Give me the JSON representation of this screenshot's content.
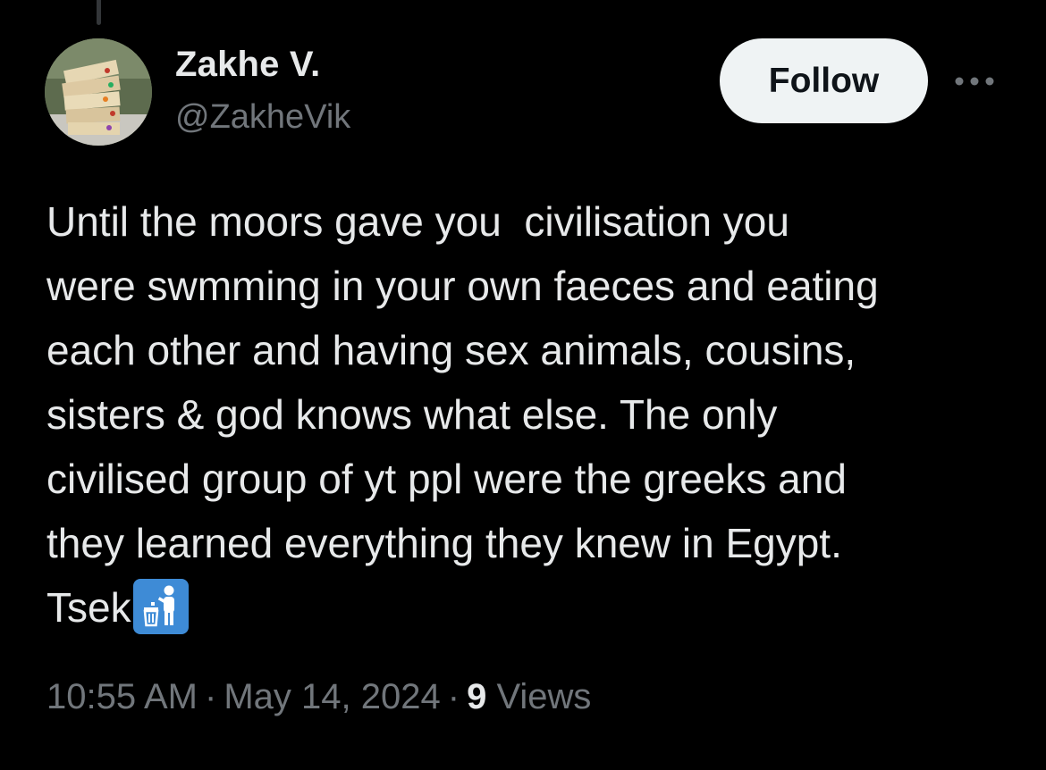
{
  "author": {
    "display_name": "Zakhe V.",
    "handle": "@ZakheVik"
  },
  "actions": {
    "follow_label": "Follow",
    "more_icon": "more-horizontal-icon"
  },
  "tweet": {
    "text": "Until the moors gave you  civilisation you\nwere swmming in your own faeces and eating\neach other and having sex animals, cousins,\nsisters & god knows what else. The only\ncivilised group of yt ppl were the greeks and\nthey learned everything they knew in Egypt.\nTsek",
    "emoji": "put-litter-in-its-place-icon"
  },
  "meta": {
    "time": "10:55 AM",
    "separator": "·",
    "date": "May 14, 2024",
    "views_count": "9",
    "views_label": "Views"
  },
  "colors": {
    "background": "#000000",
    "primary_text": "#e7e9ea",
    "secondary_text": "#71767b",
    "follow_bg": "#eff3f4",
    "follow_text": "#0f1419",
    "emoji_bg": "#3e8bd6"
  }
}
